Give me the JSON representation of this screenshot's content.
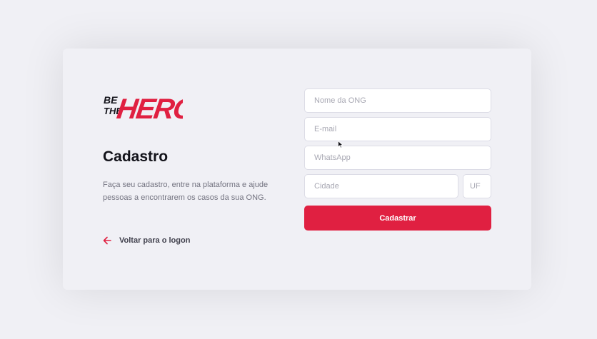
{
  "brand": {
    "logo_top": "BE",
    "logo_mid": "THE",
    "logo_main": "HERO",
    "accent_color": "#e02041"
  },
  "left": {
    "title": "Cadastro",
    "description": "Faça seu cadastro, entre na plataforma e ajude pessoas a encontrarem os casos da sua ONG.",
    "back_link_label": "Voltar para o logon",
    "back_icon": "arrow-left-icon"
  },
  "form": {
    "name_placeholder": "Nome da ONG",
    "email_placeholder": "E-mail",
    "whatsapp_placeholder": "WhatsApp",
    "city_placeholder": "Cidade",
    "uf_placeholder": "UF",
    "submit_label": "Cadastrar"
  }
}
